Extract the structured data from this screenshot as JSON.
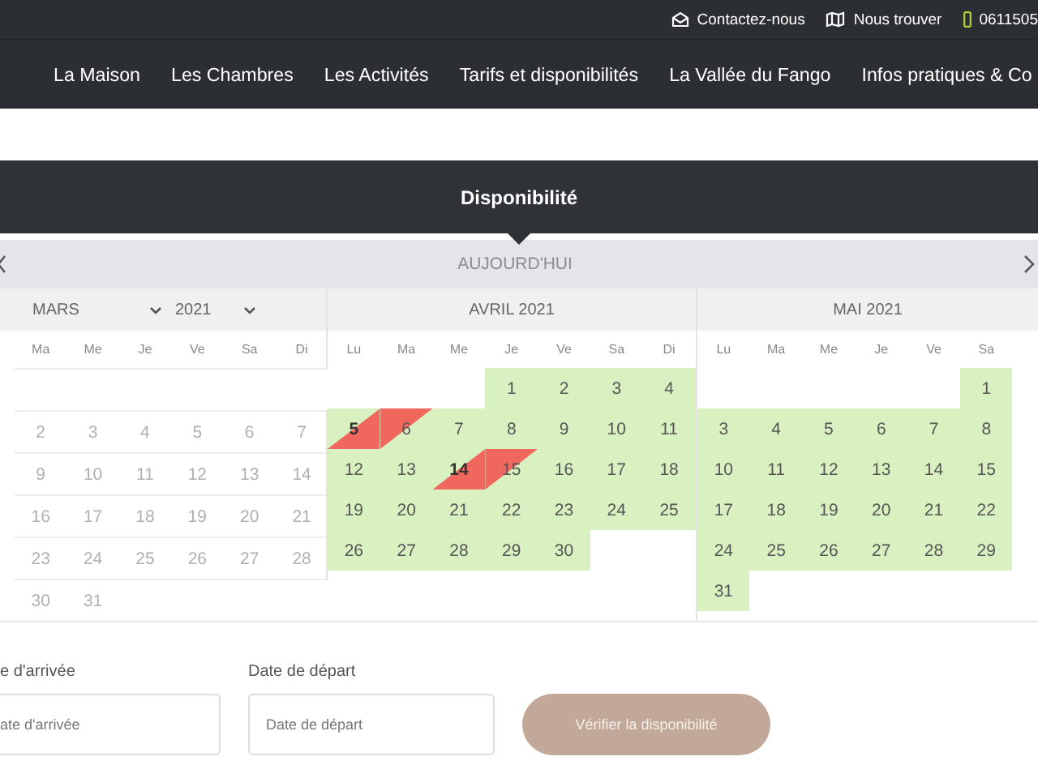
{
  "topbar": {
    "links": [
      {
        "kind": "mail",
        "label": "Contactez-nous"
      },
      {
        "kind": "map",
        "label": "Nous trouver"
      },
      {
        "kind": "phone",
        "label": "0611505"
      }
    ]
  },
  "nav": {
    "items": [
      "La Maison",
      "Les Chambres",
      "Les Activités",
      "Tarifs et disponibilités",
      "La Vallée du Fango",
      "Infos pratiques & Co"
    ]
  },
  "availability": {
    "title": "Disponibilité"
  },
  "calendar": {
    "today": "AUJOURD'HUI",
    "months": [
      {
        "kind": "select",
        "month": "MARS",
        "year": "2021",
        "weekdays": [
          "Ma",
          "Me",
          "Je",
          "Ve",
          "Sa",
          "Di"
        ],
        "weeks": [
          [
            {
              "kind": "blank"
            },
            {
              "kind": "blank"
            },
            {
              "kind": "blank"
            },
            {
              "kind": "blank"
            },
            {
              "kind": "blank"
            },
            {
              "kind": "blank"
            }
          ],
          [
            {
              "d": "2",
              "kind": "past"
            },
            {
              "d": "3",
              "kind": "past"
            },
            {
              "d": "4",
              "kind": "past"
            },
            {
              "d": "5",
              "kind": "past"
            },
            {
              "d": "6",
              "kind": "past"
            },
            {
              "d": "7",
              "kind": "past"
            }
          ],
          [
            {
              "d": "9",
              "kind": "past"
            },
            {
              "d": "10",
              "kind": "past"
            },
            {
              "d": "11",
              "kind": "past"
            },
            {
              "d": "12",
              "kind": "past"
            },
            {
              "d": "13",
              "kind": "past"
            },
            {
              "d": "14",
              "kind": "past"
            }
          ],
          [
            {
              "d": "16",
              "kind": "past"
            },
            {
              "d": "17",
              "kind": "past"
            },
            {
              "d": "18",
              "kind": "past"
            },
            {
              "d": "19",
              "kind": "past"
            },
            {
              "d": "20",
              "kind": "past"
            },
            {
              "d": "21",
              "kind": "past"
            }
          ],
          [
            {
              "d": "23",
              "kind": "past"
            },
            {
              "d": "24",
              "kind": "past"
            },
            {
              "d": "25",
              "kind": "past"
            },
            {
              "d": "26",
              "kind": "past"
            },
            {
              "d": "27",
              "kind": "past"
            },
            {
              "d": "28",
              "kind": "past"
            }
          ],
          [
            {
              "d": "30",
              "kind": "past"
            },
            {
              "d": "31",
              "kind": "past"
            },
            {
              "kind": "blank"
            },
            {
              "kind": "blank"
            },
            {
              "kind": "blank"
            },
            {
              "kind": "blank"
            }
          ]
        ]
      },
      {
        "kind": "title",
        "title": "AVRIL 2021",
        "weekdays": [
          "Lu",
          "Ma",
          "Me",
          "Je",
          "Ve",
          "Sa",
          "Di"
        ],
        "weeks": [
          [
            {
              "kind": "blank"
            },
            {
              "kind": "blank"
            },
            {
              "kind": "blank"
            },
            {
              "d": "1",
              "kind": "free"
            },
            {
              "d": "2",
              "kind": "free"
            },
            {
              "d": "3",
              "kind": "free"
            },
            {
              "d": "4",
              "kind": "free"
            }
          ],
          [
            {
              "d": "5",
              "kind": "checkin"
            },
            {
              "d": "6",
              "kind": "checkout"
            },
            {
              "d": "7",
              "kind": "free"
            },
            {
              "d": "8",
              "kind": "free"
            },
            {
              "d": "9",
              "kind": "free"
            },
            {
              "d": "10",
              "kind": "free"
            },
            {
              "d": "11",
              "kind": "free"
            }
          ],
          [
            {
              "d": "12",
              "kind": "free"
            },
            {
              "d": "13",
              "kind": "free"
            },
            {
              "d": "14",
              "kind": "checkin"
            },
            {
              "d": "15",
              "kind": "checkout"
            },
            {
              "d": "16",
              "kind": "free"
            },
            {
              "d": "17",
              "kind": "free"
            },
            {
              "d": "18",
              "kind": "free"
            }
          ],
          [
            {
              "d": "19",
              "kind": "free"
            },
            {
              "d": "20",
              "kind": "free"
            },
            {
              "d": "21",
              "kind": "free"
            },
            {
              "d": "22",
              "kind": "free"
            },
            {
              "d": "23",
              "kind": "free"
            },
            {
              "d": "24",
              "kind": "free"
            },
            {
              "d": "25",
              "kind": "free"
            }
          ],
          [
            {
              "d": "26",
              "kind": "free"
            },
            {
              "d": "27",
              "kind": "free"
            },
            {
              "d": "28",
              "kind": "free"
            },
            {
              "d": "29",
              "kind": "free"
            },
            {
              "d": "30",
              "kind": "free"
            },
            {
              "kind": "blank"
            },
            {
              "kind": "blank"
            }
          ],
          [
            {
              "kind": "blank"
            },
            {
              "kind": "blank"
            },
            {
              "kind": "blank"
            },
            {
              "kind": "blank"
            },
            {
              "kind": "blank"
            },
            {
              "kind": "blank"
            },
            {
              "kind": "blank"
            }
          ]
        ]
      },
      {
        "kind": "title",
        "title": "MAI 2021",
        "weekdays": [
          "Lu",
          "Ma",
          "Me",
          "Je",
          "Ve",
          "Sa"
        ],
        "weeks": [
          [
            {
              "kind": "blank"
            },
            {
              "kind": "blank"
            },
            {
              "kind": "blank"
            },
            {
              "kind": "blank"
            },
            {
              "kind": "blank"
            },
            {
              "d": "1",
              "kind": "free"
            }
          ],
          [
            {
              "d": "3",
              "kind": "free"
            },
            {
              "d": "4",
              "kind": "free"
            },
            {
              "d": "5",
              "kind": "free"
            },
            {
              "d": "6",
              "kind": "free"
            },
            {
              "d": "7",
              "kind": "free"
            },
            {
              "d": "8",
              "kind": "free"
            }
          ],
          [
            {
              "d": "10",
              "kind": "free"
            },
            {
              "d": "11",
              "kind": "free"
            },
            {
              "d": "12",
              "kind": "free"
            },
            {
              "d": "13",
              "kind": "free"
            },
            {
              "d": "14",
              "kind": "free"
            },
            {
              "d": "15",
              "kind": "free"
            }
          ],
          [
            {
              "d": "17",
              "kind": "free"
            },
            {
              "d": "18",
              "kind": "free"
            },
            {
              "d": "19",
              "kind": "free"
            },
            {
              "d": "20",
              "kind": "free"
            },
            {
              "d": "21",
              "kind": "free"
            },
            {
              "d": "22",
              "kind": "free"
            }
          ],
          [
            {
              "d": "24",
              "kind": "free"
            },
            {
              "d": "25",
              "kind": "free"
            },
            {
              "d": "26",
              "kind": "free"
            },
            {
              "d": "27",
              "kind": "free"
            },
            {
              "d": "28",
              "kind": "free"
            },
            {
              "d": "29",
              "kind": "free"
            }
          ],
          [
            {
              "d": "31",
              "kind": "free"
            },
            {
              "kind": "blank"
            },
            {
              "kind": "blank"
            },
            {
              "kind": "blank"
            },
            {
              "kind": "blank"
            },
            {
              "kind": "blank"
            }
          ]
        ]
      }
    ]
  },
  "form": {
    "arrival": {
      "label": "e d'arrivée",
      "placeholder": "ate d'arrivée"
    },
    "departure": {
      "label": "Date de départ",
      "placeholder": "Date de départ"
    },
    "button": "Vérifier la disponibilité"
  }
}
